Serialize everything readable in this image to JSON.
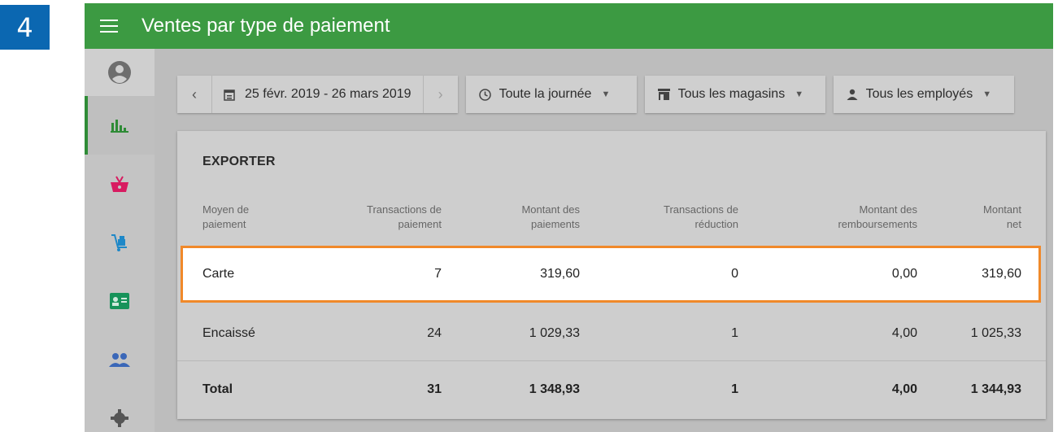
{
  "step": {
    "number": "4"
  },
  "header": {
    "title": "Ventes par type de paiement"
  },
  "filters": {
    "date_range": "25 févr. 2019 - 26 mars 2019",
    "time": "Toute la journée",
    "stores": "Tous les magasins",
    "employees": "Tous les employés"
  },
  "card": {
    "export_label": "EXPORTER"
  },
  "table": {
    "headers": [
      [
        "Moyen de",
        "paiement"
      ],
      [
        "Transactions de",
        "paiement"
      ],
      [
        "Montant des",
        "paiements"
      ],
      [
        "Transactions de",
        "réduction"
      ],
      [
        "Montant des",
        "remboursements"
      ],
      [
        "Montant",
        "net"
      ]
    ],
    "rows": [
      {
        "method": "Carte",
        "transactions": "7",
        "amount": "319,60",
        "discount_tx": "0",
        "refunds": "0,00",
        "net": "319,60"
      },
      {
        "method": "Encaissé",
        "transactions": "24",
        "amount": "1 029,33",
        "discount_tx": "1",
        "refunds": "4,00",
        "net": "1 025,33"
      },
      {
        "method": "Total",
        "transactions": "31",
        "amount": "1 348,93",
        "discount_tx": "1",
        "refunds": "4,00",
        "net": "1 344,93"
      }
    ]
  },
  "colors": {
    "header_green": "#3c9a42",
    "highlight_border": "#f0892a",
    "step_badge": "#0b67b1"
  },
  "icons": {
    "sidebar": [
      "account-circle-icon",
      "bar-chart-icon",
      "basket-icon",
      "inventory-icon",
      "customer-card-icon",
      "employees-icon",
      "settings-icon"
    ]
  }
}
